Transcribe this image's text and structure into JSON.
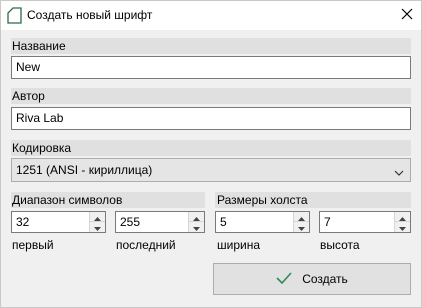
{
  "window": {
    "title": "Создать новый шрифт",
    "app_icon": "document-page-icon",
    "close_icon": "close-icon"
  },
  "name_section": {
    "label": "Название",
    "value": "New"
  },
  "author_section": {
    "label": "Автор",
    "value": "Riva Lab"
  },
  "encoding_section": {
    "label": "Кодировка",
    "selected": "1251 (ANSI - кириллица)",
    "arrow_icon": "chevron-down-icon"
  },
  "char_range": {
    "label": "Диапазон символов",
    "first": {
      "value": "32",
      "label": "первый"
    },
    "last": {
      "value": "255",
      "label": "последний"
    }
  },
  "canvas_size": {
    "label": "Размеры холста",
    "width": {
      "value": "5",
      "label": "ширина"
    },
    "height": {
      "value": "7",
      "label": "высота"
    }
  },
  "create_button": {
    "label": "Создать",
    "icon": "checkmark-icon"
  },
  "colors": {
    "window_bg": "#f0f0f0",
    "section_bar": "#e0e0e0",
    "checkmark": "#2e8b57"
  }
}
